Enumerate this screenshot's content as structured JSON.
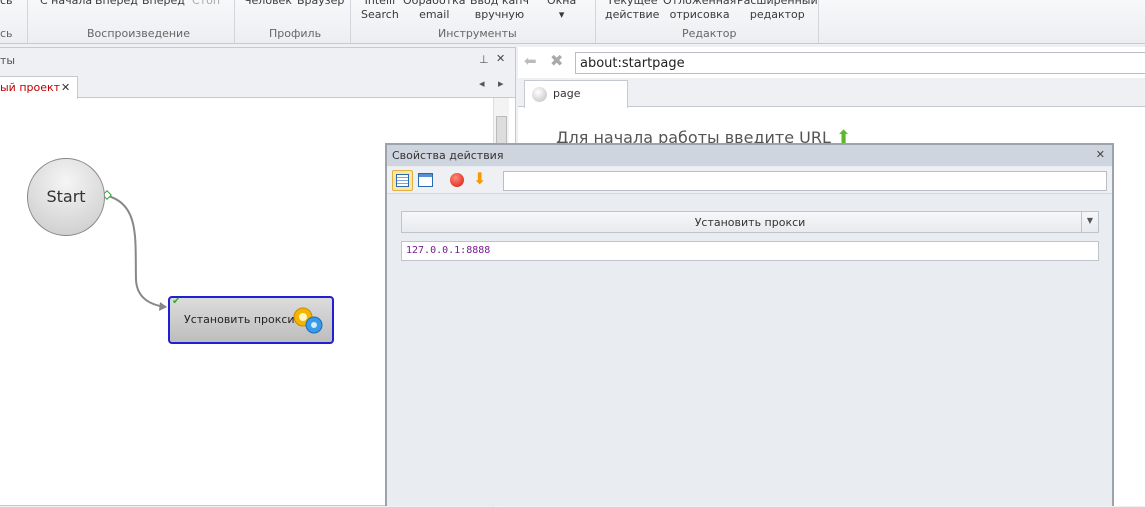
{
  "ribbon": {
    "buttons": [
      "сь",
      "С начала",
      "Вперед",
      "Вперед",
      "Стоп",
      "Человек",
      "Браузер",
      "Intelli\nSearch",
      "Обработка\nemail",
      "Ввод капч\nвручную",
      "Окна\n▾",
      "Текущее\nдействие",
      "Отложенная\nотрисовка",
      "Расширенный\nредактор"
    ],
    "groups": [
      "сь",
      "Воспроизведение",
      "Профиль",
      "Инструменты",
      "Редактор"
    ]
  },
  "left_panel": {
    "title": "ты",
    "tab_label": "ый проект",
    "tab_close": "✕",
    "pin": "⊥",
    "close": "✕",
    "nav_left": "◂",
    "nav_right": "▸"
  },
  "canvas": {
    "start_label": "Start",
    "action_label": "Установить прокси"
  },
  "browser": {
    "url": "about:startpage",
    "tab_label": "page",
    "hint": "Для начала работы введите URL"
  },
  "dialog": {
    "title": "Свойства действия",
    "close": "✕",
    "search_value": "",
    "action_select": "Установить прокси",
    "proxy_value": "127.0.0.1:8888"
  },
  "colors": {
    "accent": "#2020d0",
    "tab_text": "#c00000",
    "proxy_text": "#7a1a8c"
  }
}
